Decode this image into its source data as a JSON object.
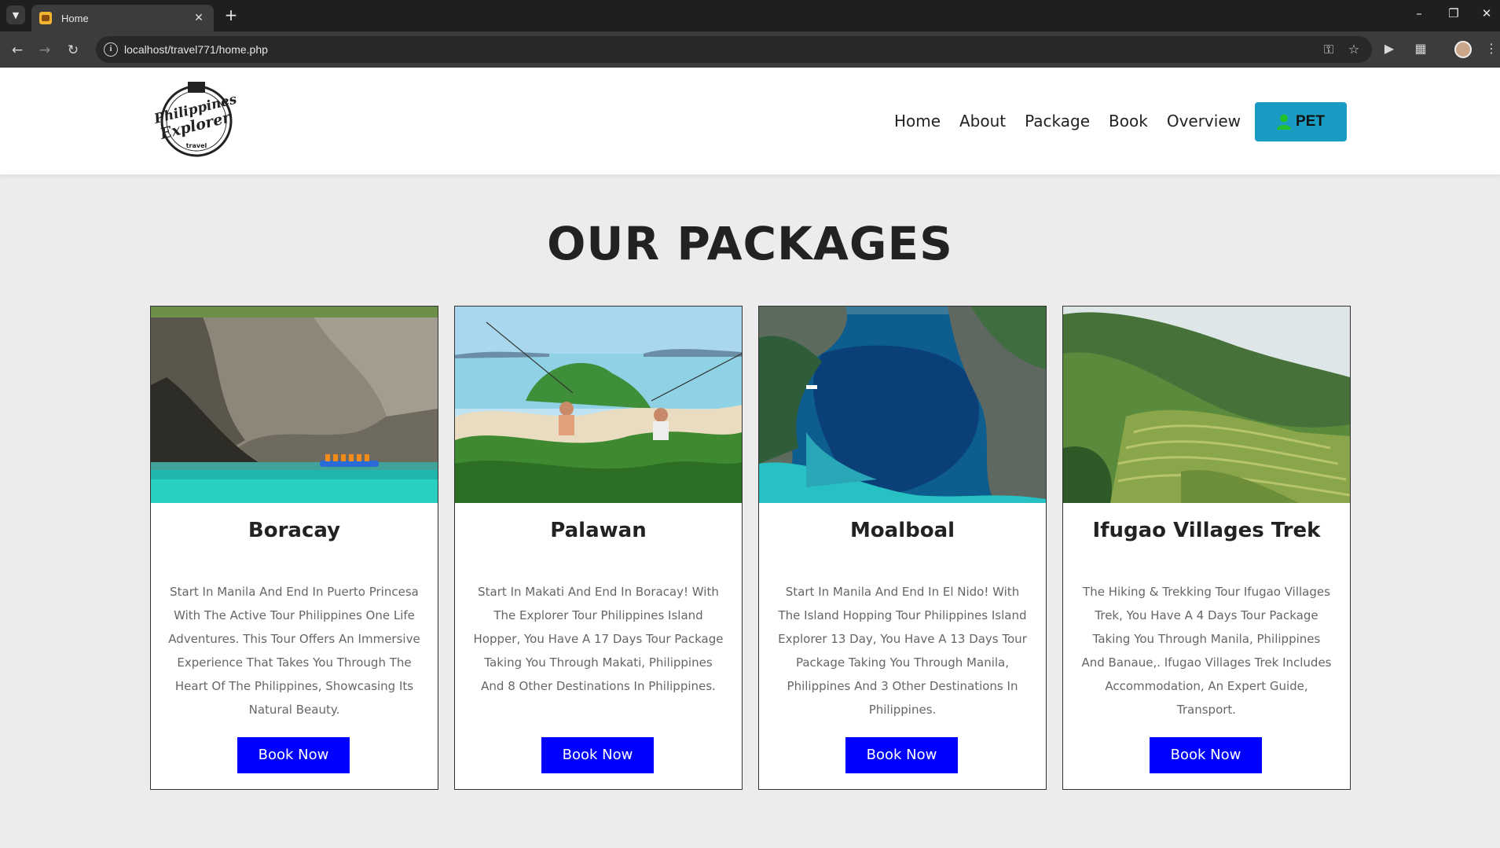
{
  "browser": {
    "tab_title": "Home",
    "url": "localhost/travel771/home.php"
  },
  "site": {
    "logo": {
      "line1": "Philippines",
      "line2": "Explorer",
      "line3": "travel"
    },
    "nav": [
      "Home",
      "About",
      "Package",
      "Book",
      "Overview"
    ],
    "user_button_label": "PET",
    "colors": {
      "user_button": "#1a9bc4",
      "book_button": "#0000ff",
      "user_icon": "#22c22e"
    }
  },
  "packages": {
    "title": "OUR PACKAGES",
    "items": [
      {
        "name": "Boracay",
        "description": "Start In Manila And End In Puerto Princesa With The Active Tour Philippines One Life Adventures. This Tour Offers An Immersive Experience That Takes You Through The Heart Of The Philippines, Showcasing Its Natural Beauty.",
        "button": "Book Now"
      },
      {
        "name": "Palawan",
        "description": "Start In Makati And End In Boracay! With The Explorer Tour Philippines Island Hopper, You Have A 17 Days Tour Package Taking You Through Makati, Philippines And 8 Other Destinations In Philippines.",
        "button": "Book Now"
      },
      {
        "name": "Moalboal",
        "description": "Start In Manila And End In El Nido! With The Island Hopping Tour Philippines Island Explorer 13 Day, You Have A 13 Days Tour Package Taking You Through Manila, Philippines And 3 Other Destinations In Philippines.",
        "button": "Book Now"
      },
      {
        "name": "Ifugao Villages Trek",
        "description": "The Hiking & Trekking Tour Ifugao Villages Trek, You Have A 4 Days Tour Package Taking You Through Manila, Philippines And Banaue,. Ifugao Villages Trek Includes Accommodation, An Expert Guide, Transport.",
        "button": "Book Now"
      }
    ]
  }
}
